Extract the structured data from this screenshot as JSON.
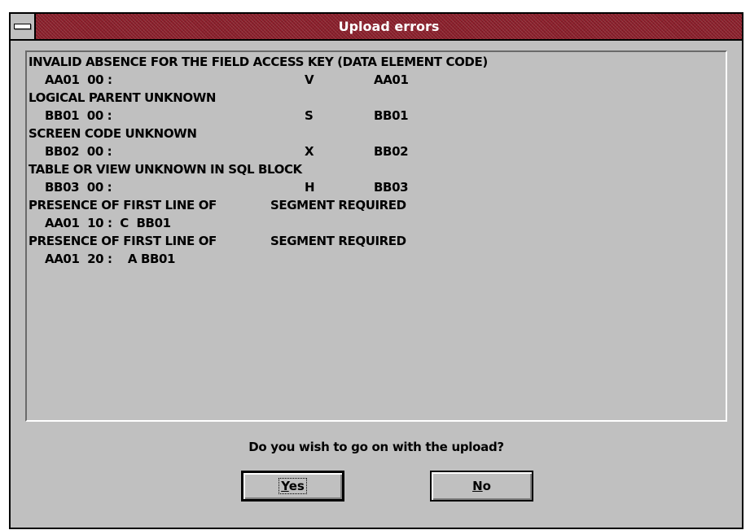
{
  "window": {
    "title": "Upload errors"
  },
  "errors": [
    {
      "text": "INVALID ABSENCE FOR THE FIELD ACCESS KEY (DATA ELEMENT CODE)"
    },
    {
      "text": "AA01  00 :",
      "code": "V",
      "ref": "AA01"
    },
    {
      "text": "LOGICAL PARENT UNKNOWN"
    },
    {
      "text": "BB01  00 :",
      "code": "S",
      "ref": "BB01"
    },
    {
      "text": "SCREEN CODE UNKNOWN"
    },
    {
      "text": "BB02  00 :",
      "code": "X",
      "ref": "BB02"
    },
    {
      "text": "TABLE OR VIEW UNKNOWN IN SQL BLOCK"
    },
    {
      "text": "BB03  00 :",
      "code": "H",
      "ref": "BB03"
    },
    {
      "text": "PRESENCE OF FIRST LINE OF",
      "code": "SEGMENT REQUIRED"
    },
    {
      "text": "AA01  10 :  C  BB01"
    },
    {
      "text": "PRESENCE OF FIRST LINE OF",
      "code": "SEGMENT REQUIRED"
    },
    {
      "text": "AA01  20 :    A BB01"
    }
  ],
  "dialog": {
    "question": "Do you wish to go on with the upload?",
    "yes_mnemonic": "Y",
    "yes_rest": "es",
    "no_mnemonic": "N",
    "no_rest": "o"
  },
  "colors": {
    "title_bar": "#8b1f2b",
    "face": "#c0c0c0"
  }
}
